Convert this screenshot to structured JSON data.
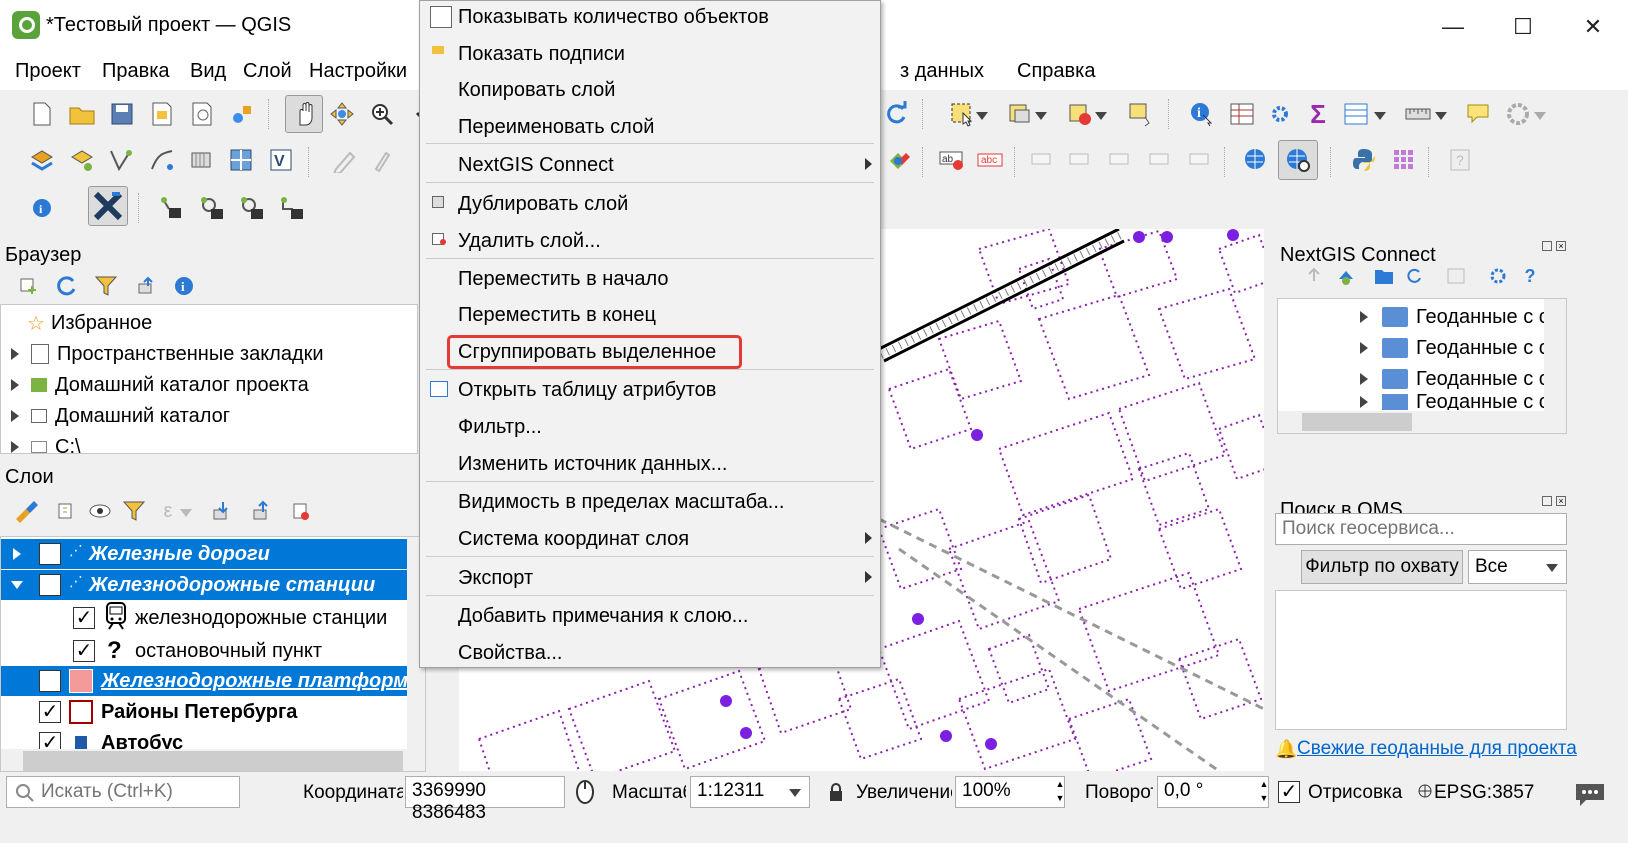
{
  "window": {
    "title": "*Тестовый проект — QGIS",
    "minimize": "—",
    "maximize": "☐",
    "close": "✕"
  },
  "menubar": [
    "Проект",
    "Правка",
    "Вид",
    "Слой",
    "Настройки",
    "з данных",
    "Справка"
  ],
  "browser": {
    "title": "Браузер",
    "items": [
      {
        "label": "Избранное"
      },
      {
        "label": "Пространственные закладки"
      },
      {
        "label": "Домашний каталог проекта"
      },
      {
        "label": "Домашний каталог"
      },
      {
        "label": "C:\\"
      }
    ]
  },
  "layers": {
    "title": "Слои",
    "items": [
      {
        "label": "Железные дороги"
      },
      {
        "label": "Железнодорожные станции"
      },
      {
        "label": "железнодорожные станции"
      },
      {
        "label": "остановочный пункт"
      },
      {
        "label": "Железнодорожные платформы"
      },
      {
        "label": "Районы Петербурга"
      },
      {
        "label": "Автобус"
      }
    ],
    "question_mark": "?"
  },
  "context_menu": {
    "items": [
      "Показывать количество объектов",
      "Показать подписи",
      "Копировать слой",
      "Переименовать слой",
      "NextGIS Connect",
      "Дублировать слой",
      "Удалить слой...",
      "Переместить в начало",
      "Переместить в конец",
      "Сгруппировать выделенное",
      "Открыть таблицу атрибутов",
      "Фильтр...",
      "Изменить источник данных...",
      "Видимость в пределах масштаба...",
      "Система координат слоя",
      "Экспорт",
      "Добавить примечания к слою...",
      "Свойства..."
    ],
    "highlighted": "Сгруппировать выделенное"
  },
  "nextgis": {
    "title": "NextGIS Connect",
    "items": [
      "Геоданные с с",
      "Геоданные с с",
      "Геоданные с с",
      "Геоданные с с"
    ]
  },
  "qms": {
    "title": "Поиск в QMS",
    "search_placeholder": "Поиск геосервиса...",
    "filter_button": "Фильтр по охвату",
    "filter_select": "Все",
    "news_link": "Свежие геоданные для проекта"
  },
  "statusbar": {
    "search_placeholder": "Искать (Ctrl+K)",
    "coord_label": "Координата",
    "coord_value": "3369990 8386483",
    "scale_label": "Масштаб",
    "scale_value": "1:12311",
    "magnifier_label": "Увеличение",
    "magnifier_value": "100%",
    "rotation_label": "Поворот",
    "rotation_value": "0,0 °",
    "render_label": "Отрисовка",
    "crs": "EPSG:3857"
  },
  "colors": {
    "accent": "#0078d7",
    "highlight": "#e53935",
    "building": "#8b1fa9",
    "point": "#7b1fe0"
  }
}
